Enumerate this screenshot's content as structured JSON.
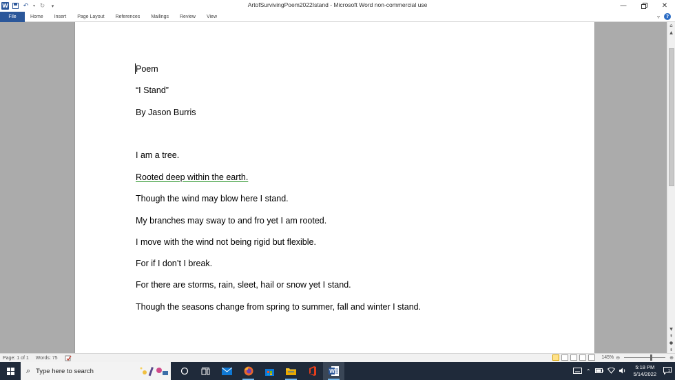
{
  "window": {
    "title": "ArtofSurvivingPoem2022Istand  -  Microsoft Word non-commercial use"
  },
  "ribbon": {
    "tabs": [
      "File",
      "Home",
      "Insert",
      "Page Layout",
      "References",
      "Mailings",
      "Review",
      "View"
    ]
  },
  "document": {
    "lines": [
      "Poem",
      "“I Stand”",
      "By Jason Burris",
      "I am a tree.",
      "Rooted deep within the earth.",
      "Though the wind may blow here I stand.",
      "My branches may sway to and fro yet I am rooted.",
      "I move with the wind not being rigid but flexible.",
      "For if I don’t I break.",
      "For there are storms, rain, sleet, hail or snow yet I stand.",
      "Though the seasons change from spring to summer, fall and winter I stand."
    ]
  },
  "status": {
    "page": "Page: 1 of 1",
    "words": "Words: 75",
    "zoom": "145%"
  },
  "taskbar": {
    "search_placeholder": "Type here to search",
    "time": "5:18 PM",
    "date": "5/14/2022"
  },
  "colors": {
    "word_blue": "#2b579a",
    "taskbar": "#1f2a3a",
    "grammar_underline": "#3a9b3a"
  }
}
